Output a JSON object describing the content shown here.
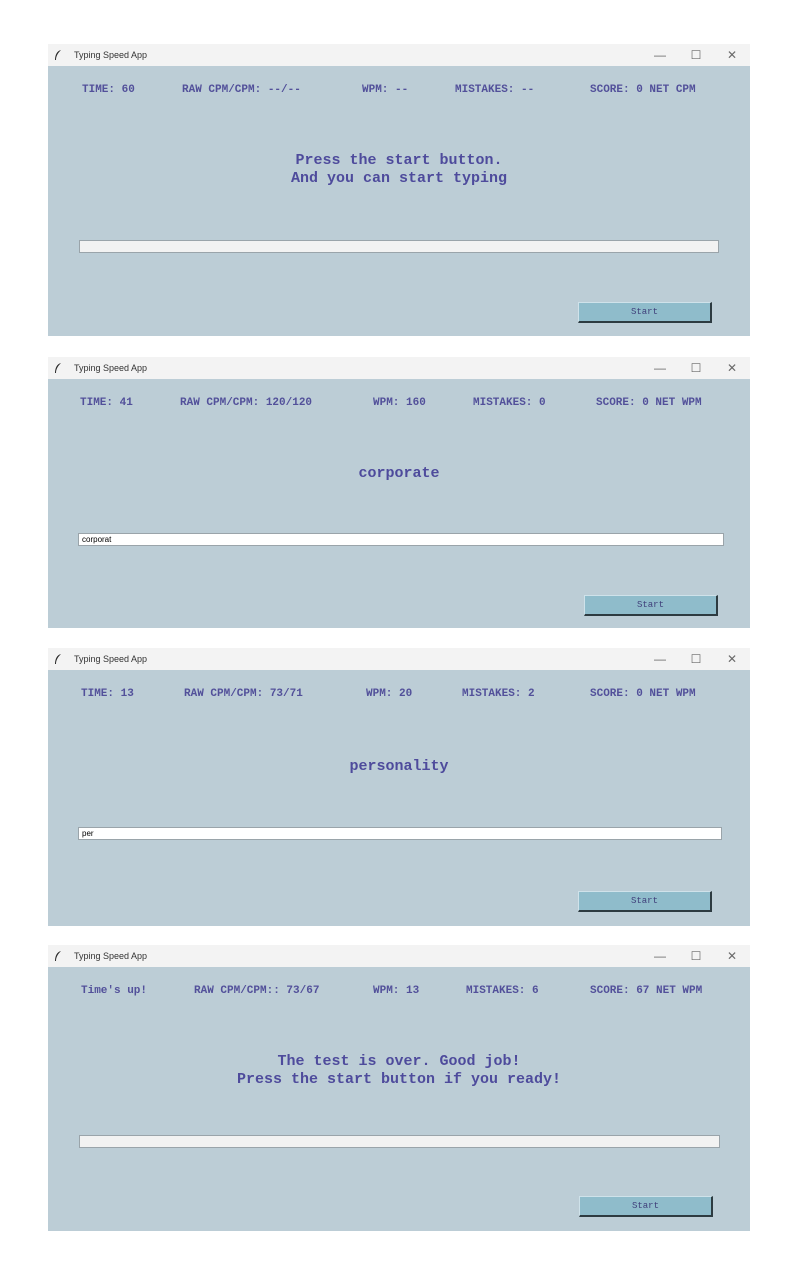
{
  "windows": [
    {
      "title": "Typing Speed App",
      "controls": {
        "minimize": "—",
        "maximize": "☐",
        "close": "✕"
      },
      "stats": {
        "time": "TIME: 60",
        "cpm": "RAW CPM/CPM: --/--",
        "wpm": "WPM: --",
        "mistakes": "MISTAKES: --",
        "score": "SCORE: 0 NET CPM"
      },
      "message": "Press the start button.\nAnd you can start typing",
      "entry": {
        "value": "",
        "state": "disabled"
      },
      "start_label": "Start"
    },
    {
      "title": "Typing Speed App",
      "controls": {
        "minimize": "—",
        "maximize": "☐",
        "close": "✕"
      },
      "stats": {
        "time": "TIME: 41",
        "cpm": "RAW CPM/CPM: 120/120",
        "wpm": "WPM: 160",
        "mistakes": "MISTAKES: 0",
        "score": "SCORE: 0 NET WPM"
      },
      "message": "corporate",
      "entry": {
        "value": "corporat",
        "state": "enabled"
      },
      "start_label": "Start"
    },
    {
      "title": "Typing Speed App",
      "controls": {
        "minimize": "—",
        "maximize": "☐",
        "close": "✕"
      },
      "stats": {
        "time": "TIME: 13",
        "cpm": "RAW CPM/CPM: 73/71",
        "wpm": "WPM: 20",
        "mistakes": "MISTAKES: 2",
        "score": "SCORE: 0 NET WPM"
      },
      "message": "personality",
      "entry": {
        "value": "per",
        "state": "enabled"
      },
      "start_label": "Start"
    },
    {
      "title": "Typing Speed App",
      "controls": {
        "minimize": "—",
        "maximize": "☐",
        "close": "✕"
      },
      "stats": {
        "time": "Time's up!",
        "cpm": "RAW CPM/CPM:: 73/67",
        "wpm": "WPM: 13",
        "mistakes": "MISTAKES: 6",
        "score": "SCORE: 67 NET WPM"
      },
      "message": "The test is over. Good job!\nPress the start button if you ready!",
      "entry": {
        "value": "",
        "state": "disabled"
      },
      "start_label": "Start"
    }
  ]
}
